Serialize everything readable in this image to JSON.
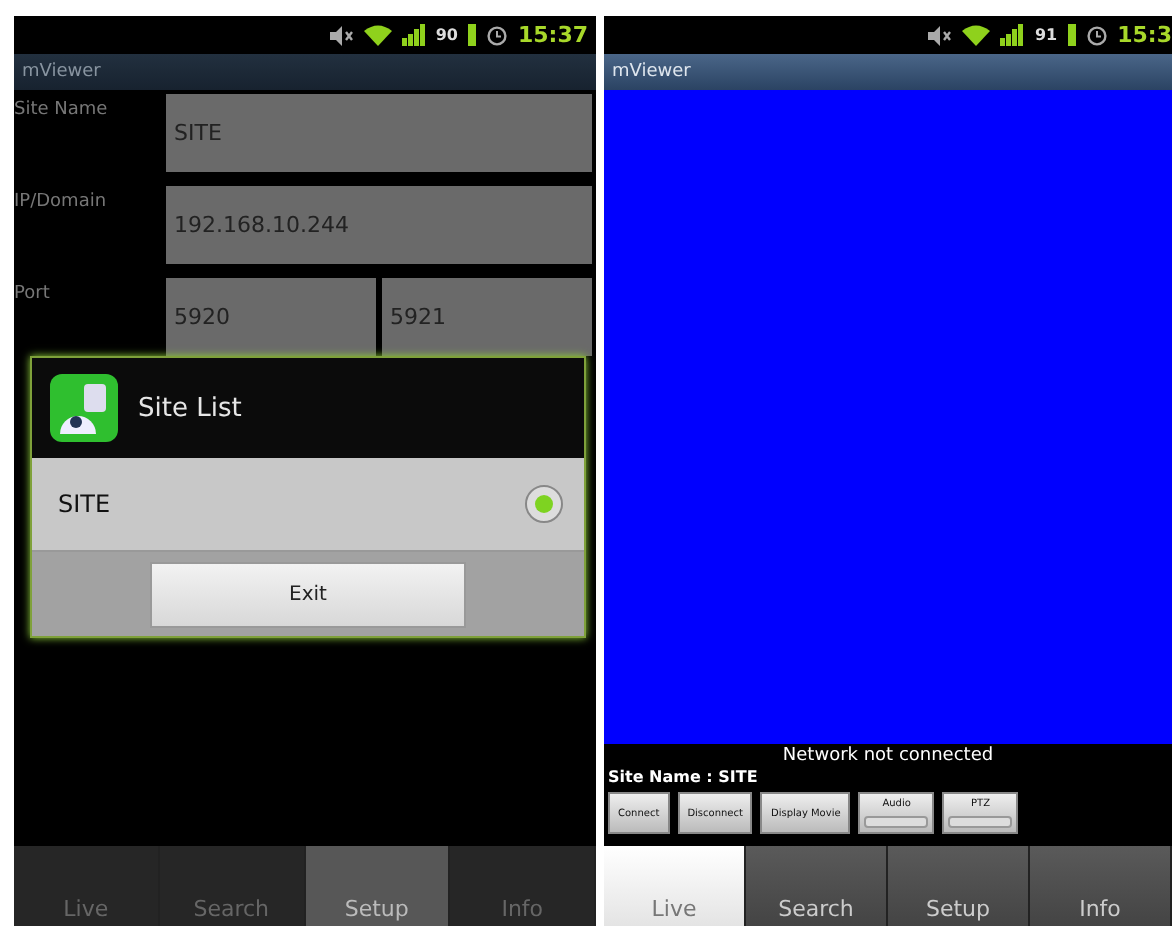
{
  "setup_screen": {
    "status_bar": {
      "battery": "90",
      "time": "15:37"
    },
    "title": "mViewer",
    "fields": [
      {
        "label": "Site Name",
        "values": [
          "SITE"
        ]
      },
      {
        "label": "IP/Domain",
        "values": [
          "192.168.10.244"
        ]
      },
      {
        "label": "Port",
        "values": [
          "5920",
          "5921"
        ]
      }
    ],
    "dialog": {
      "title": "Site List",
      "items": [
        {
          "label": "SITE",
          "selected": true
        }
      ],
      "button": "Exit"
    },
    "tabs": [
      {
        "label": "Live",
        "selected": false
      },
      {
        "label": "Search",
        "selected": false
      },
      {
        "label": "Setup",
        "selected": true
      },
      {
        "label": "Info",
        "selected": false
      }
    ]
  },
  "live_screen": {
    "status_bar": {
      "battery": "91",
      "time": "15:3"
    },
    "title": "mViewer",
    "message": "Network not connected",
    "site_name": "Site Name : SITE",
    "controls": [
      {
        "label": "Connect",
        "kind": "button"
      },
      {
        "label": "Disconnect",
        "kind": "button"
      },
      {
        "label": "Display Movie",
        "kind": "button"
      },
      {
        "label": "Audio",
        "kind": "bar",
        "level": 0
      },
      {
        "label": "PTZ",
        "kind": "bar",
        "level": 0
      }
    ],
    "tabs": [
      {
        "label": "Live",
        "selected": true
      },
      {
        "label": "Search",
        "selected": false
      },
      {
        "label": "Setup",
        "selected": false
      },
      {
        "label": "Info",
        "selected": false
      }
    ]
  }
}
